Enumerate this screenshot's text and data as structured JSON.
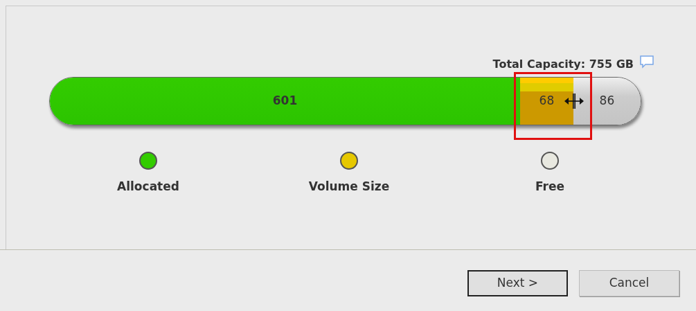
{
  "capacity": {
    "label": "Total Capacity: 755 GB"
  },
  "segments": [
    {
      "kind": "allocated",
      "value": "601",
      "selected": false
    },
    {
      "kind": "volume",
      "value": "68",
      "selected": true
    },
    {
      "kind": "free",
      "value": "86",
      "selected": false
    }
  ],
  "legend": [
    {
      "label": "Allocated",
      "color": "#33cc00"
    },
    {
      "label": "Volume Size",
      "color": "#e6c800"
    },
    {
      "label": "Free",
      "color": "#e8e8e0"
    }
  ],
  "buttons": [
    {
      "label": "Next >",
      "kind": "default"
    },
    {
      "label": "Cancel",
      "kind": "normal"
    }
  ]
}
